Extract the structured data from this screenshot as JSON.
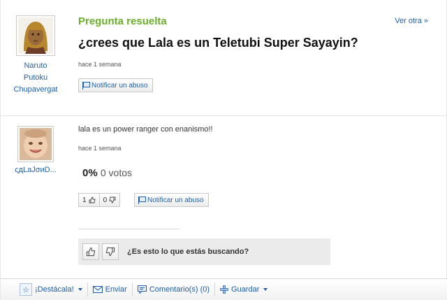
{
  "question": {
    "status": "Pregunta resuelta",
    "more_link": "Ver otra »",
    "title": "¿crees que Lala es un Teletubi Super Sayayin?",
    "time": "hace 1 semana",
    "report_label": "Notificar un abuso",
    "asker": {
      "name_lines": [
        "Naruto",
        "Putoku",
        "Chupavergat"
      ]
    }
  },
  "answer": {
    "text": "lala es un power ranger con enanismo!!",
    "time": "hace 1 semana",
    "percent": "0%",
    "votes": "0 votos",
    "thumbs_up_count": "1",
    "thumbs_down_count": "0",
    "report_label": "Notificar un abuso",
    "answerer": {
      "name": "ςдLaJσиD..."
    }
  },
  "seek": {
    "question": "¿Es esto lo que estás buscando?"
  },
  "toolbar": {
    "highlight_label": "¡Destácala!",
    "send_label": "Enviar",
    "comments_label": "Comentario(s) (0)",
    "save_label": "Guardar"
  },
  "colors": {
    "accent_green": "#6aae2a",
    "link_blue": "#1f5fa8"
  }
}
